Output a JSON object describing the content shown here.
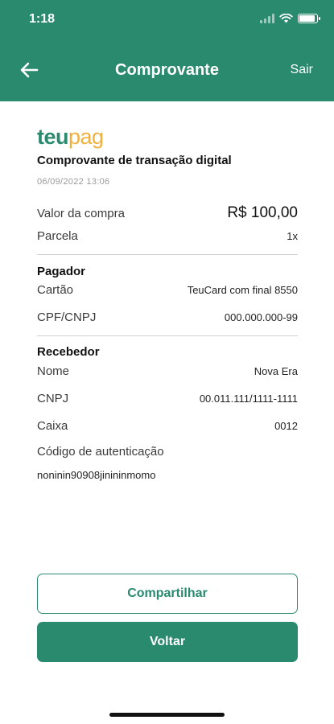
{
  "status_bar": {
    "time": "1:18",
    "battery_level": 0.9
  },
  "header": {
    "title": "Comprovante",
    "exit_label": "Sair",
    "back_icon": "arrow-left-icon",
    "color": "#2a8a6e"
  },
  "logo": {
    "part1": "teu",
    "part2": "pag",
    "colors": {
      "teu": "#2a8a6e",
      "pag": "#f2b03d"
    }
  },
  "receipt": {
    "title": "Comprovante de transação digital",
    "date": "06/09/2022 13:06",
    "purchase": {
      "amount_label": "Valor da compra",
      "amount": "R$ 100,00",
      "installment_label": "Parcela",
      "installment": "1x"
    },
    "payer": {
      "title": "Pagador",
      "card_label": "Cartão",
      "card": "TeuCard com final 8550",
      "doc_label": "CPF/CNPJ",
      "doc": "000.000.000-99"
    },
    "receiver": {
      "title": "Recebedor",
      "name_label": "Nome",
      "name": "Nova Era",
      "cnpj_label": "CNPJ",
      "cnpj": "00.011.111/1111-1111",
      "cashier_label": "Caixa",
      "cashier": "0012",
      "auth_label": "Código de autenticação",
      "auth_code": "noninin90908jinininmomo"
    }
  },
  "actions": {
    "share_label": "Compartilhar",
    "back_label": "Voltar"
  }
}
